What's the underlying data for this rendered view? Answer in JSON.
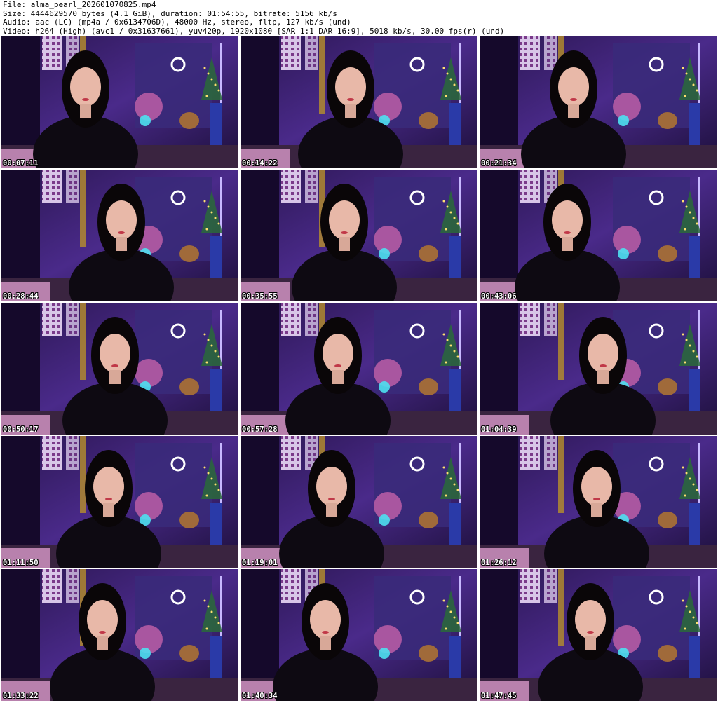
{
  "header": {
    "file": "File: alma_pearl_202601070825.mp4",
    "size": "Size: 4444629570 bytes (4.1 GiB), duration: 01:54:55, bitrate: 5156 kb/s",
    "audio": "Audio: aac (LC) (mp4a / 0x6134706D), 48000 Hz, stereo, fltp, 127 kb/s (und)",
    "video": "Video: h264 (High) (avc1 / 0x31637661), yuv420p, 1920x1080 [SAR 1:1 DAR 16:9], 5018 kb/s, 30.00 fps(r) (und)"
  },
  "thumbnails": [
    {
      "timestamp": "00:07:11"
    },
    {
      "timestamp": "00:14:22"
    },
    {
      "timestamp": "00:21:34"
    },
    {
      "timestamp": "00:28:44"
    },
    {
      "timestamp": "00:35:55"
    },
    {
      "timestamp": "00:43:06"
    },
    {
      "timestamp": "00:50:17"
    },
    {
      "timestamp": "00:57:28"
    },
    {
      "timestamp": "01:04:39"
    },
    {
      "timestamp": "01:11:50"
    },
    {
      "timestamp": "01:19:01"
    },
    {
      "timestamp": "01:26:12"
    },
    {
      "timestamp": "01:33:22"
    },
    {
      "timestamp": "01:40:34"
    },
    {
      "timestamp": "01:47:45"
    }
  ],
  "colors": {
    "background": "#ffffff",
    "text": "#000000",
    "scene_dark": "#1a0f36",
    "scene_purple": "#6a3fc0",
    "accent_pink": "#d08ab0",
    "accent_cyan": "#3fd6e8"
  }
}
